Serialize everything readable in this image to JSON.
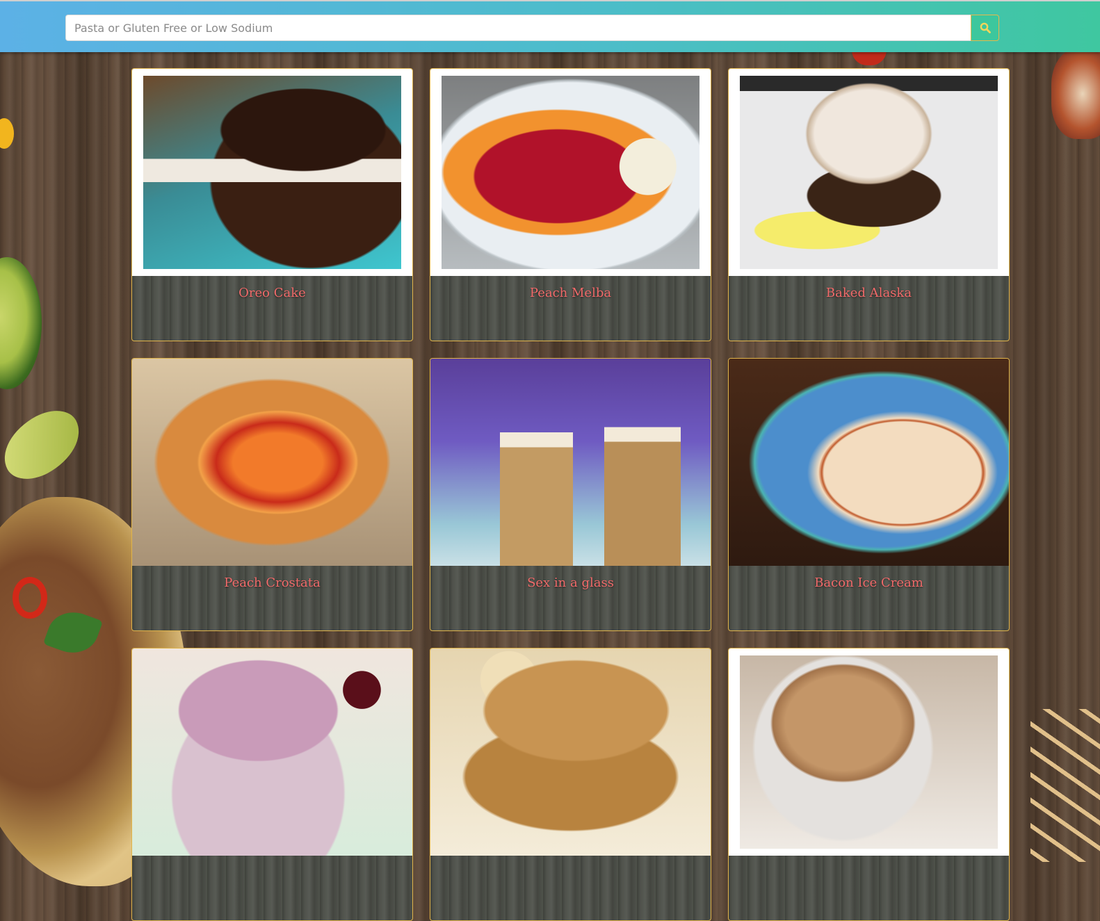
{
  "search": {
    "placeholder": "Pasta or Gluten Free or Low Sodium",
    "value": ""
  },
  "icons": {
    "search_button": "search-icon"
  },
  "colors": {
    "header_gradient_start": "#5cb1e6",
    "header_gradient_end": "#3fc7a0",
    "card_border": "#e0b44a",
    "card_title": "#f16a6a"
  },
  "recipes": [
    {
      "title": "Oreo Cake"
    },
    {
      "title": "Peach Melba"
    },
    {
      "title": "Baked Alaska"
    },
    {
      "title": "Peach Crostata"
    },
    {
      "title": "Sex in a glass"
    },
    {
      "title": "Bacon Ice Cream"
    },
    {
      "title": ""
    },
    {
      "title": ""
    },
    {
      "title": ""
    }
  ]
}
